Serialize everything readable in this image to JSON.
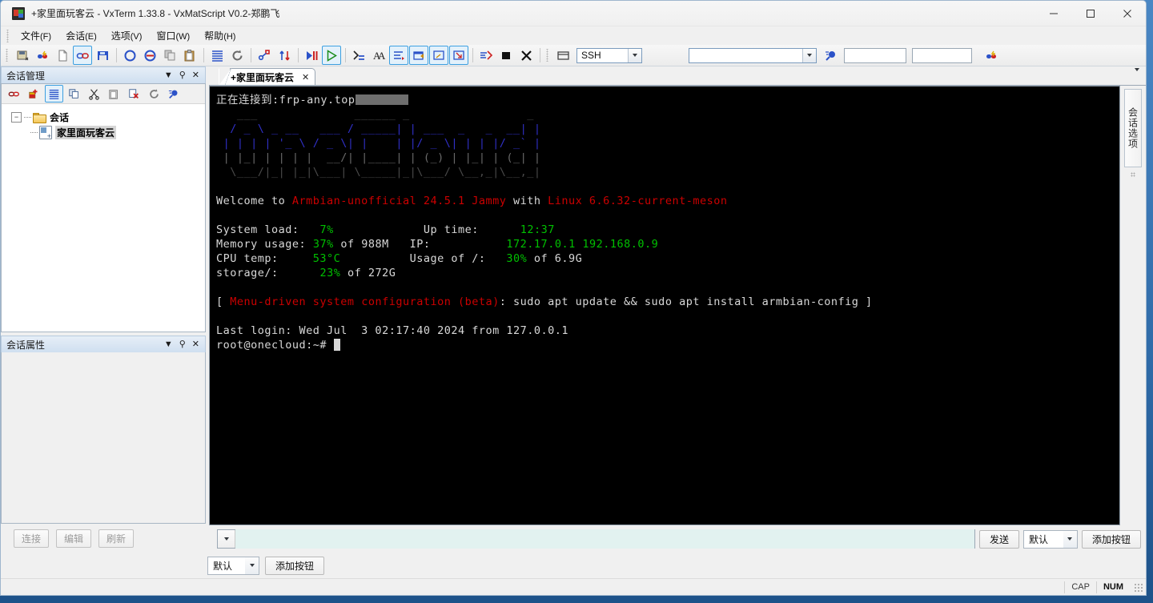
{
  "window": {
    "title": "+家里面玩客云 - VxTerm 1.33.8 - VxMatScript V0.2-郑鹏飞",
    "minimize": "−",
    "maximize": "□",
    "close": "✕"
  },
  "menubar": {
    "items": [
      {
        "label": "文件",
        "mnemonic": "(F)"
      },
      {
        "label": "会话",
        "mnemonic": "(E)"
      },
      {
        "label": "选项",
        "mnemonic": "(V)"
      },
      {
        "label": "窗口",
        "mnemonic": "(W)"
      },
      {
        "label": "帮助",
        "mnemonic": "(H)"
      }
    ]
  },
  "toolbar": {
    "icons": [
      "save-session-icon",
      "quick-connect-icon",
      "new-file-icon",
      "connect-link-icon",
      "save-as-icon",
      "disconnect-circle-icon",
      "disconnect-all-icon",
      "copy-icon",
      "paste-icon",
      "log-lines-icon",
      "refresh-icon",
      "transfer-icon",
      "upload-download-icon",
      "play-pause-icon",
      "run-script-icon",
      "command-prompt-icon",
      "find-icon",
      "clear-screen-icon",
      "window-new-icon",
      "window-tile-icon",
      "window-export-icon",
      "send-all-icon",
      "stop-icon",
      "close-x-icon",
      "window-mode-icon"
    ],
    "protocol_value": "SSH",
    "combo_value": "",
    "search_value": "",
    "field_value": "",
    "end_icon": "quick-connect-icon"
  },
  "session_manager": {
    "title": "会话管理",
    "header_icons": [
      "chevron-down-icon",
      "pin-icon",
      "close-icon"
    ],
    "toolbar_icons": [
      "connect-icon",
      "add-session-icon",
      "list-view-icon",
      "copy-icon",
      "cut-icon",
      "paste-icon",
      "delete-icon",
      "refresh-icon",
      "search-icon"
    ],
    "tree": {
      "root": {
        "label": "会话",
        "expander": "−",
        "icon": "folder-icon"
      },
      "children": [
        {
          "label": "家里面玩客云",
          "icon": "session-icon",
          "selected": true
        }
      ]
    }
  },
  "session_properties": {
    "title": "会话属性",
    "header_icons": [
      "chevron-down-icon",
      "pin-icon",
      "close-icon"
    ]
  },
  "left_footer": {
    "buttons": [
      "连接",
      "编辑",
      "刷新"
    ]
  },
  "tabs": [
    {
      "label": "+家里面玩客云",
      "close": "✕",
      "active": true
    }
  ],
  "right_dock": {
    "vertical_tab": "会话选项"
  },
  "terminal": {
    "connect_prefix": "正在连接到:",
    "connect_host": "frp-any.top",
    "banner_lines": [
      "   ___              ______ _                 _ ",
      "  / _ \\ _ __   ___ / _____| | ___  _   _  __| |",
      " | | | | '_ \\ / _ \\| |    | |/ _ \\| | | |/ _` |",
      " | |_| | | | |  __/| |____| | (_) | |_| | (_| |",
      "  \\___/|_| |_|\\___| \\_____|_|\\___/ \\__,_|\\__,_|"
    ],
    "welcome": {
      "prefix": "Welcome to ",
      "distro": "Armbian-unofficial 24.5.1 Jammy",
      "middle": " with ",
      "kernel": "Linux 6.6.32-current-meson"
    },
    "stats_left": [
      {
        "label": "System load:",
        "value": "7%",
        "extra": ""
      },
      {
        "label": "Memory usage:",
        "value": "37%",
        "extra": " of 988M"
      },
      {
        "label": "CPU temp:",
        "value": "53°C",
        "extra": ""
      },
      {
        "label": "storage/:",
        "value": "23%",
        "extra": " of 272G"
      }
    ],
    "stats_right": [
      {
        "label": "Up time:",
        "value": "12:37",
        "extra": ""
      },
      {
        "label": "IP:",
        "value": "172.17.0.1 192.168.0.9",
        "extra": ""
      },
      {
        "label": "Usage of /:",
        "value": "30%",
        "extra": " of 6.9G"
      }
    ],
    "menu_line": {
      "open": "[ ",
      "red": "Menu-driven system configuration (beta)",
      "rest": ": sudo apt update && sudo apt install armbian-config ]"
    },
    "last_login": "Last login: Wed Jul  3 02:17:40 2024 from 127.0.0.1",
    "prompt": "root@onecloud:~# "
  },
  "send_bar": {
    "input_value": "",
    "input_placeholder": "",
    "send_label": "发送",
    "preset_value": "默认",
    "add_button_label": "添加按钮"
  },
  "bottom_bar": {
    "preset_value": "默认",
    "add_button_label": "添加按钮"
  },
  "statusbar": {
    "cap": "CAP",
    "num": "NUM"
  }
}
